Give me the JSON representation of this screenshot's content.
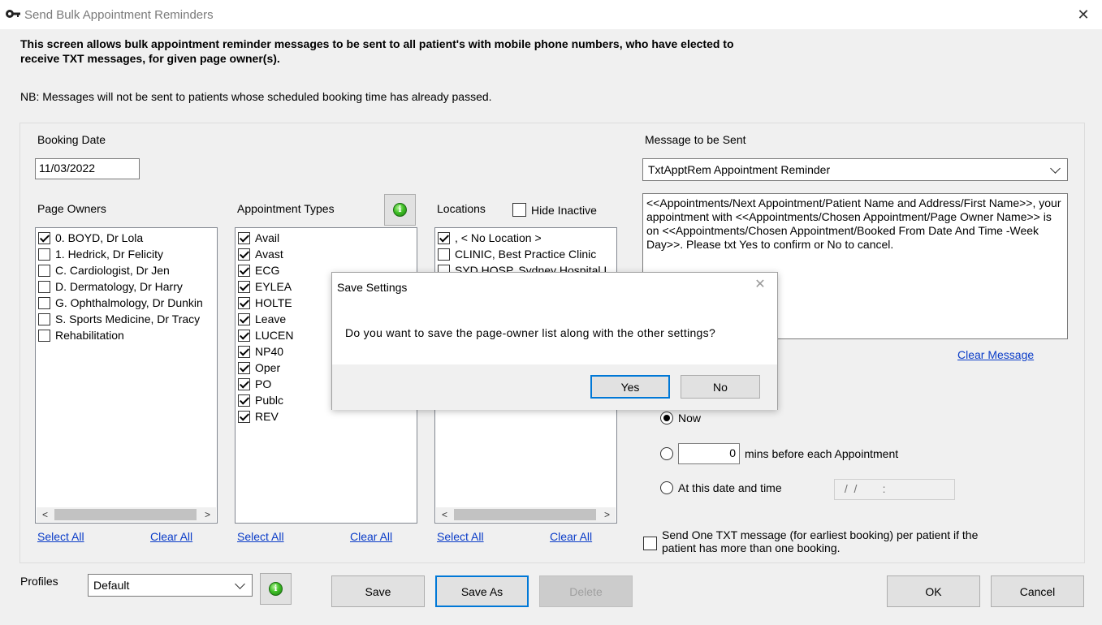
{
  "window": {
    "title": "Send Bulk Appointment Reminders",
    "close_symbol": "✕"
  },
  "intro": {
    "line1": "This screen allows bulk appointment reminder messages to be sent to all patient's with mobile phone numbers, who have elected to",
    "line2": "receive TXT messages, for given page owner(s).",
    "nb": "NB: Messages will not be sent  to patients whose scheduled booking time has already passed."
  },
  "booking": {
    "label": "Booking Date",
    "value": "11/03/2022"
  },
  "page_owners": {
    "label": "Page Owners",
    "items": [
      {
        "label": "0. BOYD, Dr Lola",
        "checked": true
      },
      {
        "label": "1. Hedrick, Dr Felicity",
        "checked": false
      },
      {
        "label": "C. Cardiologist, Dr Jen",
        "checked": false
      },
      {
        "label": "D. Dermatology, Dr Harry",
        "checked": false
      },
      {
        "label": "G. Ophthalmology, Dr Dunkin",
        "checked": false
      },
      {
        "label": "S. Sports Medicine, Dr Tracy",
        "checked": false
      },
      {
        "label": "Rehabilitation",
        "checked": false
      }
    ],
    "select_all": "Select All",
    "clear_all": "Clear All"
  },
  "appointment_types": {
    "label": "Appointment Types",
    "items": [
      {
        "label": "Avail",
        "checked": true
      },
      {
        "label": "Avast",
        "checked": true
      },
      {
        "label": "ECG",
        "checked": true
      },
      {
        "label": "EYLEA",
        "checked": true
      },
      {
        "label": "HOLTE",
        "checked": true
      },
      {
        "label": "Leave",
        "checked": true
      },
      {
        "label": "LUCEN",
        "checked": true
      },
      {
        "label": "NP40",
        "checked": true
      },
      {
        "label": "Oper",
        "checked": true
      },
      {
        "label": "PO",
        "checked": true
      },
      {
        "label": "Publc",
        "checked": true
      },
      {
        "label": "REV",
        "checked": true
      }
    ],
    "select_all": "Select All",
    "clear_all": "Clear All"
  },
  "locations": {
    "label": "Locations",
    "hide_inactive": "Hide Inactive",
    "items": [
      {
        "label": ", < No Location >",
        "checked": true
      },
      {
        "label": "CLINIC, Best Practice Clinic",
        "checked": false
      },
      {
        "label": "SYD HOSP, Sydney Hospital I",
        "checked": false
      }
    ],
    "select_all": "Select All",
    "clear_all": "Clear All"
  },
  "message": {
    "label": "Message to be Sent",
    "template": "TxtApptRem Appointment Reminder",
    "body": "<<Appointments/Next Appointment/Patient Name and Address/First Name>>, your appointment with <<Appointments/Chosen Appointment/Page Owner Name>> is on <<Appointments/Chosen Appointment/Booked From Date And Time -Week Day>>. Please txt Yes to confirm or No to cancel.",
    "clear": "Clear Message"
  },
  "send_time": {
    "now": "Now",
    "mins_value": "0",
    "mins_label": "mins before each Appointment",
    "at_date": "At this date and time",
    "date_placeholder": " /  /        :"
  },
  "one_per_patient": {
    "line1": "Send One TXT message (for earliest booking) per patient if the",
    "line2": "patient has more than one booking."
  },
  "profiles": {
    "label": "Profiles",
    "value": "Default",
    "save": "Save",
    "save_as": "Save As",
    "delete": "Delete"
  },
  "footer": {
    "ok": "OK",
    "cancel": "Cancel"
  },
  "dialog": {
    "title": "Save Settings",
    "message": "Do you want to save the page-owner list along with the other settings?",
    "yes": "Yes",
    "no": "No",
    "close_symbol": "✕"
  },
  "icons": {
    "info_glyph": "i",
    "scroll_left": "<",
    "scroll_right": ">"
  },
  "colors": {
    "link": "#0a3cc8",
    "default_button_border": "#0078d7",
    "info_green": "#3fbf26"
  }
}
